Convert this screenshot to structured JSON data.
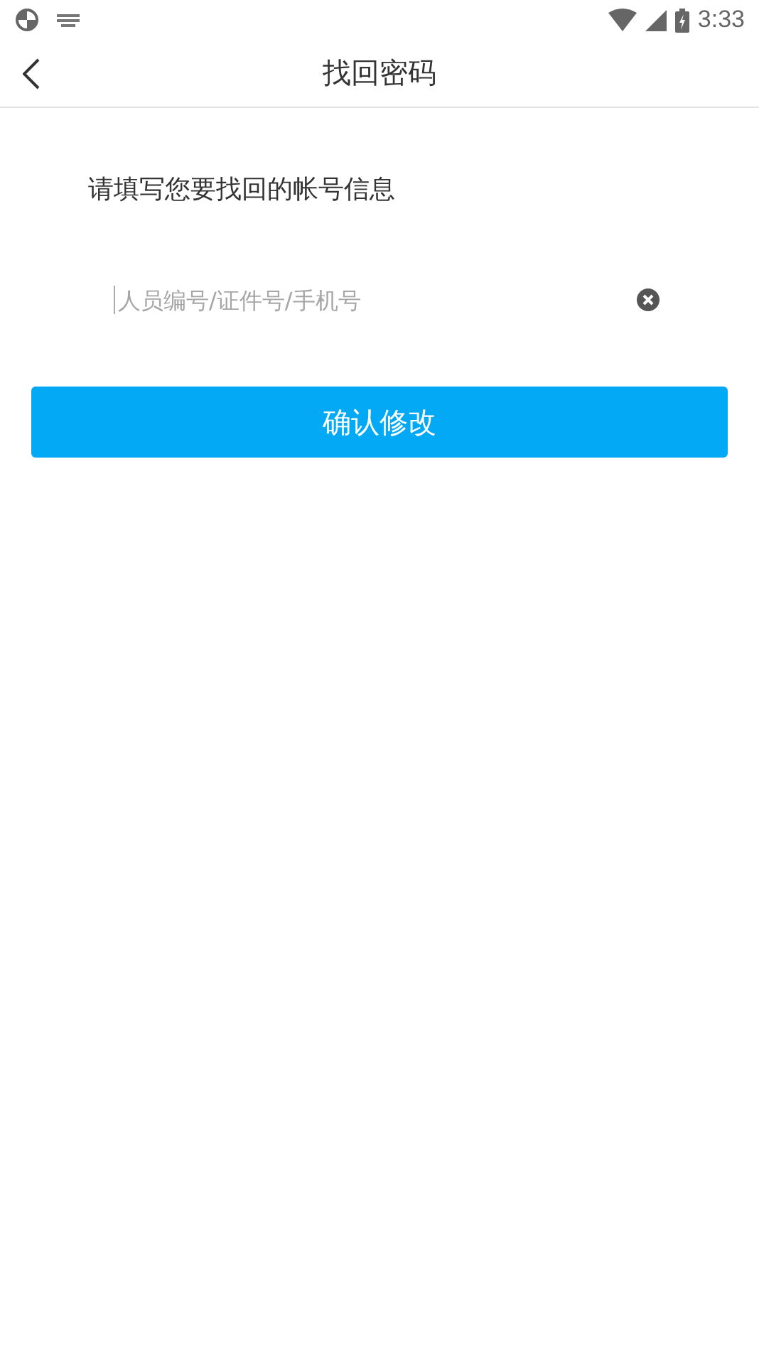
{
  "status_bar": {
    "time": "3:33"
  },
  "header": {
    "title": "找回密码"
  },
  "form": {
    "prompt": "请填写您要找回的帐号信息",
    "account_field": {
      "placeholder": "人员编号/证件号/手机号"
    },
    "submit_button": "确认修改"
  }
}
